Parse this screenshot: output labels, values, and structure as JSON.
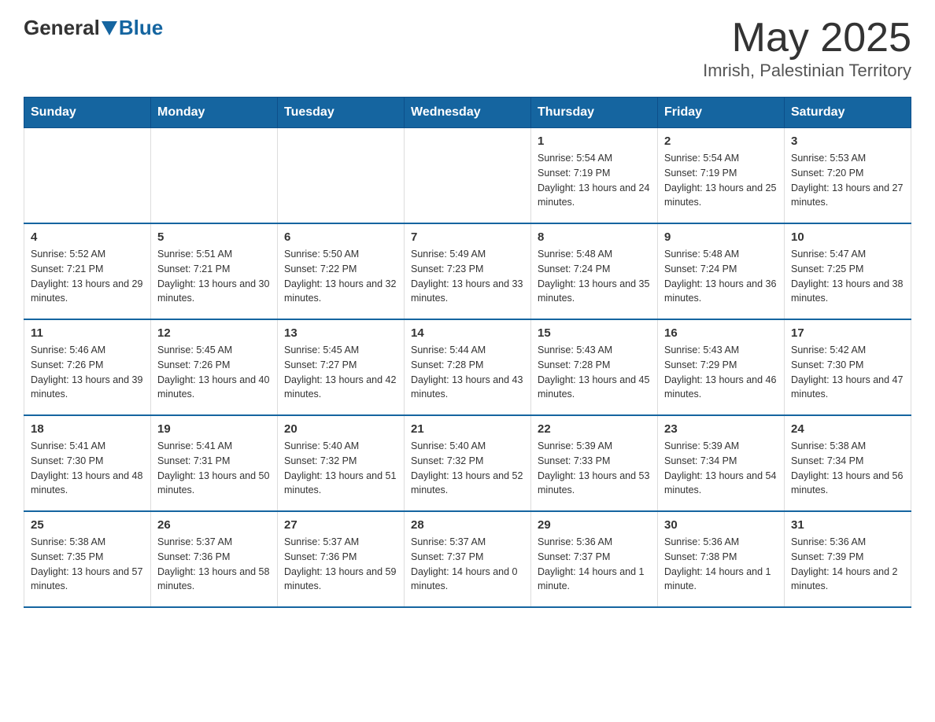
{
  "header": {
    "logo_general": "General",
    "logo_blue": "Blue",
    "month_title": "May 2025",
    "location": "Imrish, Palestinian Territory"
  },
  "weekdays": [
    "Sunday",
    "Monday",
    "Tuesday",
    "Wednesday",
    "Thursday",
    "Friday",
    "Saturday"
  ],
  "weeks": [
    [
      {
        "day": "",
        "info": ""
      },
      {
        "day": "",
        "info": ""
      },
      {
        "day": "",
        "info": ""
      },
      {
        "day": "",
        "info": ""
      },
      {
        "day": "1",
        "info": "Sunrise: 5:54 AM\nSunset: 7:19 PM\nDaylight: 13 hours and 24 minutes."
      },
      {
        "day": "2",
        "info": "Sunrise: 5:54 AM\nSunset: 7:19 PM\nDaylight: 13 hours and 25 minutes."
      },
      {
        "day": "3",
        "info": "Sunrise: 5:53 AM\nSunset: 7:20 PM\nDaylight: 13 hours and 27 minutes."
      }
    ],
    [
      {
        "day": "4",
        "info": "Sunrise: 5:52 AM\nSunset: 7:21 PM\nDaylight: 13 hours and 29 minutes."
      },
      {
        "day": "5",
        "info": "Sunrise: 5:51 AM\nSunset: 7:21 PM\nDaylight: 13 hours and 30 minutes."
      },
      {
        "day": "6",
        "info": "Sunrise: 5:50 AM\nSunset: 7:22 PM\nDaylight: 13 hours and 32 minutes."
      },
      {
        "day": "7",
        "info": "Sunrise: 5:49 AM\nSunset: 7:23 PM\nDaylight: 13 hours and 33 minutes."
      },
      {
        "day": "8",
        "info": "Sunrise: 5:48 AM\nSunset: 7:24 PM\nDaylight: 13 hours and 35 minutes."
      },
      {
        "day": "9",
        "info": "Sunrise: 5:48 AM\nSunset: 7:24 PM\nDaylight: 13 hours and 36 minutes."
      },
      {
        "day": "10",
        "info": "Sunrise: 5:47 AM\nSunset: 7:25 PM\nDaylight: 13 hours and 38 minutes."
      }
    ],
    [
      {
        "day": "11",
        "info": "Sunrise: 5:46 AM\nSunset: 7:26 PM\nDaylight: 13 hours and 39 minutes."
      },
      {
        "day": "12",
        "info": "Sunrise: 5:45 AM\nSunset: 7:26 PM\nDaylight: 13 hours and 40 minutes."
      },
      {
        "day": "13",
        "info": "Sunrise: 5:45 AM\nSunset: 7:27 PM\nDaylight: 13 hours and 42 minutes."
      },
      {
        "day": "14",
        "info": "Sunrise: 5:44 AM\nSunset: 7:28 PM\nDaylight: 13 hours and 43 minutes."
      },
      {
        "day": "15",
        "info": "Sunrise: 5:43 AM\nSunset: 7:28 PM\nDaylight: 13 hours and 45 minutes."
      },
      {
        "day": "16",
        "info": "Sunrise: 5:43 AM\nSunset: 7:29 PM\nDaylight: 13 hours and 46 minutes."
      },
      {
        "day": "17",
        "info": "Sunrise: 5:42 AM\nSunset: 7:30 PM\nDaylight: 13 hours and 47 minutes."
      }
    ],
    [
      {
        "day": "18",
        "info": "Sunrise: 5:41 AM\nSunset: 7:30 PM\nDaylight: 13 hours and 48 minutes."
      },
      {
        "day": "19",
        "info": "Sunrise: 5:41 AM\nSunset: 7:31 PM\nDaylight: 13 hours and 50 minutes."
      },
      {
        "day": "20",
        "info": "Sunrise: 5:40 AM\nSunset: 7:32 PM\nDaylight: 13 hours and 51 minutes."
      },
      {
        "day": "21",
        "info": "Sunrise: 5:40 AM\nSunset: 7:32 PM\nDaylight: 13 hours and 52 minutes."
      },
      {
        "day": "22",
        "info": "Sunrise: 5:39 AM\nSunset: 7:33 PM\nDaylight: 13 hours and 53 minutes."
      },
      {
        "day": "23",
        "info": "Sunrise: 5:39 AM\nSunset: 7:34 PM\nDaylight: 13 hours and 54 minutes."
      },
      {
        "day": "24",
        "info": "Sunrise: 5:38 AM\nSunset: 7:34 PM\nDaylight: 13 hours and 56 minutes."
      }
    ],
    [
      {
        "day": "25",
        "info": "Sunrise: 5:38 AM\nSunset: 7:35 PM\nDaylight: 13 hours and 57 minutes."
      },
      {
        "day": "26",
        "info": "Sunrise: 5:37 AM\nSunset: 7:36 PM\nDaylight: 13 hours and 58 minutes."
      },
      {
        "day": "27",
        "info": "Sunrise: 5:37 AM\nSunset: 7:36 PM\nDaylight: 13 hours and 59 minutes."
      },
      {
        "day": "28",
        "info": "Sunrise: 5:37 AM\nSunset: 7:37 PM\nDaylight: 14 hours and 0 minutes."
      },
      {
        "day": "29",
        "info": "Sunrise: 5:36 AM\nSunset: 7:37 PM\nDaylight: 14 hours and 1 minute."
      },
      {
        "day": "30",
        "info": "Sunrise: 5:36 AM\nSunset: 7:38 PM\nDaylight: 14 hours and 1 minute."
      },
      {
        "day": "31",
        "info": "Sunrise: 5:36 AM\nSunset: 7:39 PM\nDaylight: 14 hours and 2 minutes."
      }
    ]
  ]
}
